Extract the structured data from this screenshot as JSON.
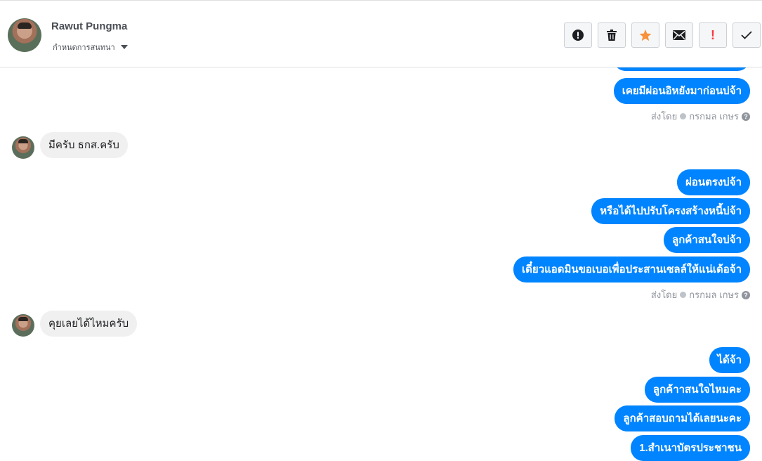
{
  "header": {
    "contact_name": "Rawut Pungma",
    "assign_label": "กำหนดการสนทนา",
    "actions": [
      {
        "icon": "alert-circle-icon"
      },
      {
        "icon": "trash-icon"
      },
      {
        "icon": "star-icon",
        "color": "#f7923b"
      },
      {
        "icon": "envelope-icon"
      },
      {
        "icon": "exclamation-icon",
        "label": "!",
        "color": "#fa383e"
      },
      {
        "icon": "check-icon"
      }
    ]
  },
  "colors": {
    "outgoing_bubble": "#0084ff",
    "incoming_bubble": "#f1f0f0"
  },
  "messages": {
    "m0": "เคยมีผ่อนอิหยังมาก่อนบ่จ้า",
    "sent0_prefix": "ส่งโดย",
    "sent0_name": "กรกมล เกษร",
    "m1": "มีครับ ธกส.ครับ",
    "m2": "ผ่อนตรงบ่จ้า",
    "m3": "หรือได้ไปปรับโครงสร้างหนี้บ่จ้า",
    "m4": "ลูกค้าสนใจบ่จ้า",
    "m5": "เดี๋ยวแอดมินขอเบอเพื่อประสานเซลล์ให้แน่เด้อจ้า",
    "sent1_prefix": "ส่งโดย",
    "sent1_name": "กรกมล เกษร",
    "m6": "คุยเลยได้ไหมครับ",
    "m7": "ได้จ้า",
    "m8": "ลูกค้าาสนใจไหมคะ",
    "m9": "ลูกค้าสอบถามได้เลยนะคะ",
    "m10": "1.สำเนาบัตรประชาชน"
  }
}
